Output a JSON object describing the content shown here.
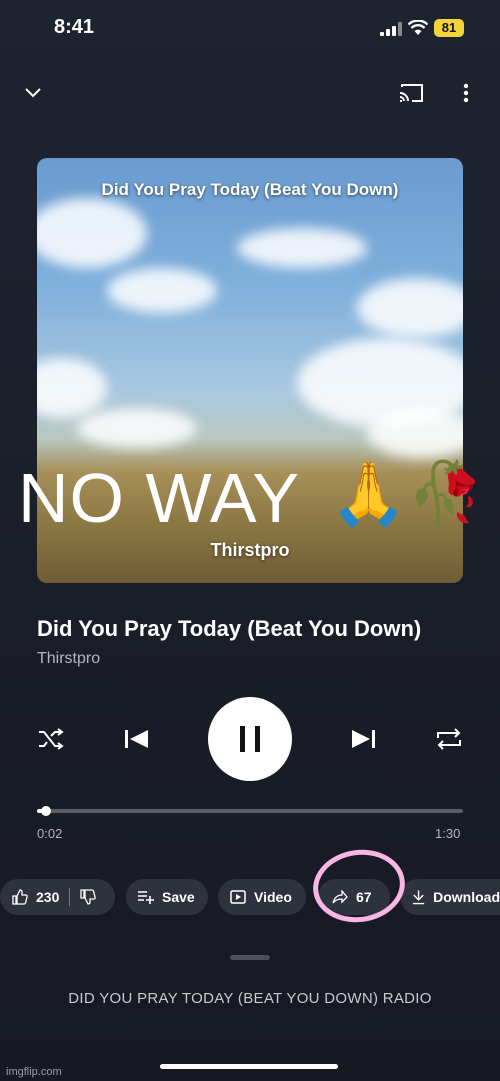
{
  "status_bar": {
    "time": "8:41",
    "battery": "81"
  },
  "artwork": {
    "title": "Did You Pray Today (Beat You Down)",
    "artist": "Thirstpro",
    "overlay_text": "NO WAY",
    "overlay_emoji": "🙏🥀"
  },
  "song": {
    "title": "Did You Pray Today (Beat You Down)",
    "artist": "Thirstpro"
  },
  "progress": {
    "current": "0:02",
    "total": "1:30",
    "fraction": 0.02
  },
  "actions": {
    "likes": "230",
    "save": "Save",
    "video": "Video",
    "share_count": "67",
    "download": "Download"
  },
  "radio_label": "DID YOU PRAY TODAY (BEAT YOU DOWN) RADIO",
  "watermark": "imgflip.com",
  "icons": [
    "chevron-down-icon",
    "cast-icon",
    "more-vert-icon",
    "shuffle-icon",
    "previous-icon",
    "pause-icon",
    "next-icon",
    "repeat-icon",
    "thumb-up-icon",
    "thumb-down-icon",
    "playlist-add-icon",
    "video-icon",
    "share-icon",
    "download-icon"
  ],
  "colors": {
    "annotation_circle": "#f7b6e3",
    "battery": "#f5d43a"
  }
}
